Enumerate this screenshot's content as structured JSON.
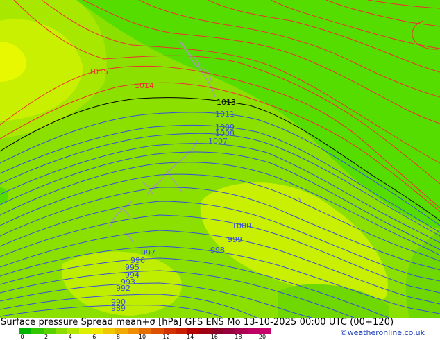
{
  "title": "Surface pressure Spread mean+σ [hPa] GFS ENS  Mo 13-10-2025 00:00 UTC (00+120)",
  "credit": "©weatheronline.co.uk",
  "colors": {
    "bright_green": "#55dd00",
    "mid_green": "#8be000",
    "light_green": "#a8e800",
    "yellow_green": "#c8f000",
    "yellow": "#dcf500",
    "red_isobar": "#ee3030",
    "blue_isobar": "#3a4fd8",
    "black_isobar": "#000000"
  },
  "isobar_labels": {
    "l1015": "1015",
    "l1014": "1014",
    "l1013": "1013",
    "l1011": "1011",
    "l1009": "1009",
    "l1008": "1008",
    "l1007": "1007",
    "l1000": "1000",
    "l999": "999",
    "l998": "998",
    "l997": "997",
    "l996": "996",
    "l995": "995",
    "l994": "994",
    "l993": "993",
    "l992": "992",
    "l990": "990",
    "l989": "989"
  },
  "legend": {
    "tick_labels": [
      "0",
      "2",
      "4",
      "6",
      "8",
      "10",
      "12",
      "14",
      "16",
      "18",
      "20"
    ],
    "swatches": [
      "#00b400",
      "#32c800",
      "#5ad200",
      "#8cdc00",
      "#b4e600",
      "#dcf000",
      "#f0e600",
      "#f0c800",
      "#f0aa00",
      "#f08c00",
      "#e66e00",
      "#dc5000",
      "#d23200",
      "#c81e00",
      "#b40000",
      "#a00014",
      "#8c0028",
      "#96003c",
      "#aa0050",
      "#be0064",
      "#c8006e"
    ]
  }
}
